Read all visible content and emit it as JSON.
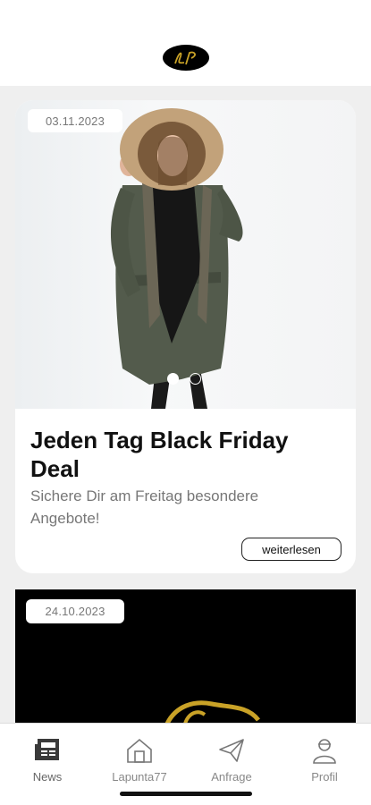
{
  "header": {
    "logo_text": "LP"
  },
  "posts": [
    {
      "date": "03.11.2023",
      "title": "Jeden Tag Black Friday Deal",
      "subtitle": "Sichere Dir am Freitag besondere Angebote!",
      "more_label": "weiterlesen",
      "carousel_index": 1,
      "carousel_count": 2
    },
    {
      "date": "24.10.2023"
    }
  ],
  "tabs": [
    {
      "label": "News",
      "icon": "newspaper-icon",
      "active": true
    },
    {
      "label": "Lapunta77",
      "icon": "home-icon",
      "active": false
    },
    {
      "label": "Anfrage",
      "icon": "paper-plane-icon",
      "active": false
    },
    {
      "label": "Profil",
      "icon": "person-icon",
      "active": false
    }
  ],
  "colors": {
    "gold": "#c9a227",
    "background": "#efefef",
    "accent_text": "#111111"
  }
}
